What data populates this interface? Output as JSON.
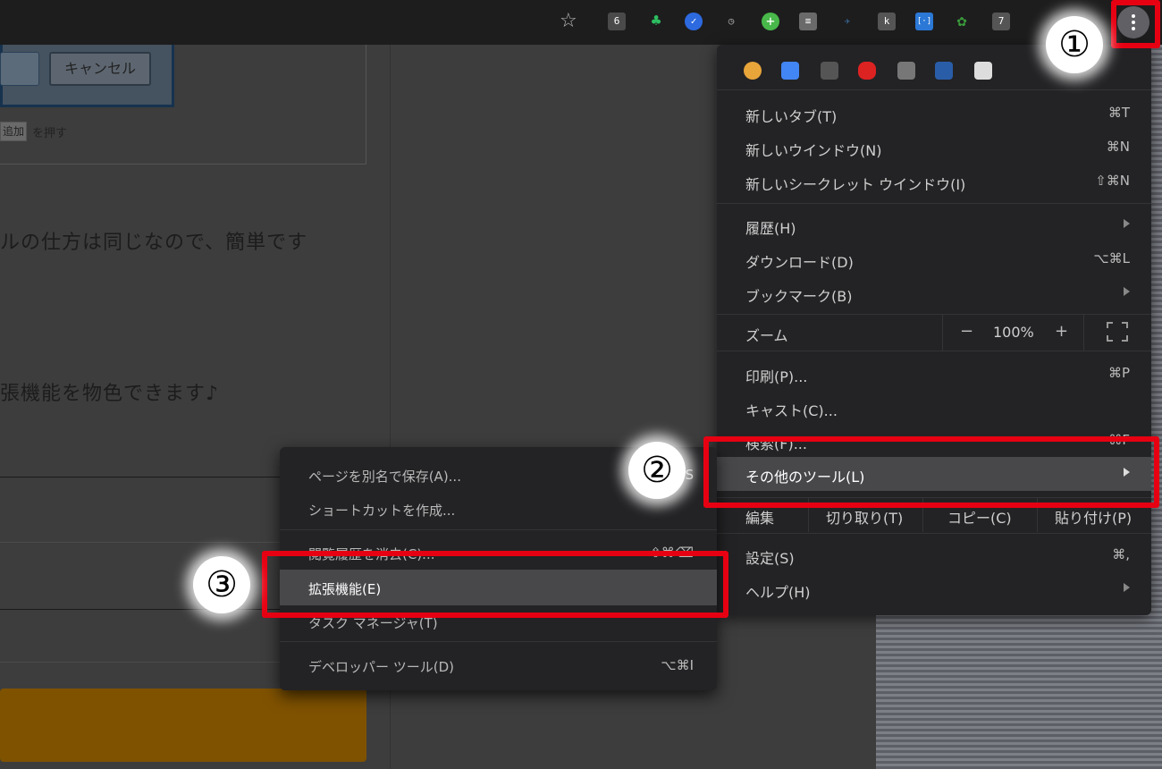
{
  "toolbar": {
    "extensions": [
      {
        "name": "ext-6-icon",
        "text": "6",
        "color": "#4a4a4a"
      },
      {
        "name": "evernote-icon",
        "text": "",
        "color": "#2dbe60"
      },
      {
        "name": "check-icon",
        "text": "",
        "color": "#2d6ae0"
      },
      {
        "name": "alarm-icon",
        "text": "",
        "color": "#555555"
      },
      {
        "name": "plus-icon",
        "text": "+",
        "color": "#48b84a"
      },
      {
        "name": "doc-icon",
        "text": "",
        "color": "#6a6a6a"
      },
      {
        "name": "bird-icon",
        "text": "",
        "color": "#3a6c9a"
      },
      {
        "name": "k-icon",
        "text": "k",
        "color": "#555555"
      },
      {
        "name": "bracket-icon",
        "text": "[·]",
        "color": "#2b78d6"
      },
      {
        "name": "puzzle-icon",
        "text": "",
        "color": "#3a9b3a"
      },
      {
        "name": "seven-icon",
        "text": "7",
        "color": "#555555"
      }
    ]
  },
  "page": {
    "cancel_label": "キャンセル",
    "add_chip": "追加",
    "add_text": "を押す",
    "text1": "ルの仕方は同じなので、簡単です",
    "text2": "張機能を物色できます♪"
  },
  "menu": {
    "items": {
      "new_tab": {
        "label": "新しいタブ(T)",
        "shortcut": "⌘T"
      },
      "new_window": {
        "label": "新しいウインドウ(N)",
        "shortcut": "⌘N"
      },
      "incognito": {
        "label": "新しいシークレット ウインドウ(I)",
        "shortcut": "⇧⌘N"
      },
      "history": {
        "label": "履歴(H)"
      },
      "downloads": {
        "label": "ダウンロード(D)",
        "shortcut": "⌥⌘L"
      },
      "bookmarks": {
        "label": "ブックマーク(B)"
      },
      "print": {
        "label": "印刷(P)...",
        "shortcut": "⌘P"
      },
      "cast": {
        "label": "キャスト(C)..."
      },
      "find": {
        "label": "検索(F)...",
        "shortcut": "⌘F"
      },
      "more_tools": {
        "label": "その他のツール(L)"
      },
      "settings": {
        "label": "設定(S)",
        "shortcut": "⌘,"
      },
      "help": {
        "label": "ヘルプ(H)"
      }
    },
    "zoom": {
      "label": "ズーム",
      "minus": "−",
      "value": "100%",
      "plus": "+"
    },
    "edit": {
      "label": "編集",
      "cut": "切り取り(T)",
      "copy": "コピー(C)",
      "paste": "貼り付け(P)"
    }
  },
  "submenu": {
    "save_as": {
      "label": "ページを別名で保存(A)...",
      "shortcut": "⌘S"
    },
    "shortcut": {
      "label": "ショートカットを作成..."
    },
    "clear_data": {
      "label": "閲覧履歴を消去(C)...",
      "shortcut": "⇧⌘⌫"
    },
    "extensions": {
      "label": "拡張機能(E)"
    },
    "task_manager": {
      "label": "タスク マネージャ(T)"
    },
    "devtools": {
      "label": "デベロッパー ツール(D)",
      "shortcut": "⌥⌘I"
    }
  },
  "steps": [
    "①",
    "②",
    "③"
  ],
  "colors": {
    "callout": "#e60012",
    "menu_bg": "#232325",
    "highlight": "#48484b"
  }
}
